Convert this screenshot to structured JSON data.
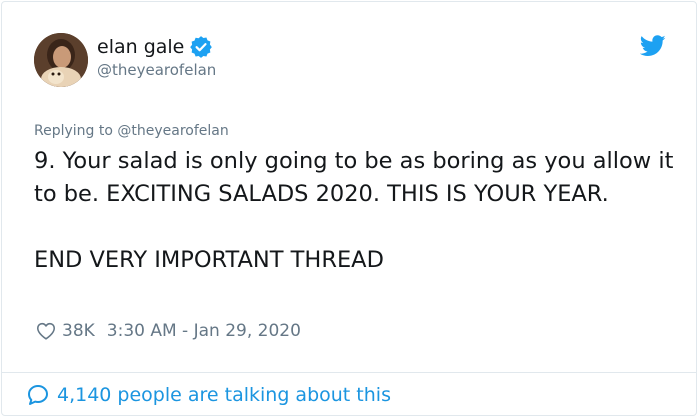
{
  "author": {
    "display_name": "elan gale",
    "handle": "@theyearofelan",
    "verified": true,
    "avatar_icon": "avatar-photo"
  },
  "reply": {
    "replying_to_text": "Replying to @theyearofelan"
  },
  "tweet": {
    "paragraph_1": "9. Your salad is only going to be as boring as you allow it to be. EXCITING SALADS 2020. THIS IS YOUR YEAR.",
    "paragraph_2": "END VERY IMPORTANT THREAD"
  },
  "meta": {
    "likes": "38K",
    "timestamp": "3:30 AM - Jan 29, 2020"
  },
  "footer": {
    "talking_text": "4,140 people are talking about this"
  },
  "icons": {
    "brand": "twitter-bird-icon",
    "verified": "verified-badge-icon",
    "like": "heart-icon",
    "reply": "speech-bubble-icon"
  },
  "colors": {
    "brand_blue": "#1da1f2",
    "link_blue": "#1b95e0",
    "muted_text": "#657786",
    "primary_text": "#14171a",
    "border": "#e1e8ed"
  }
}
